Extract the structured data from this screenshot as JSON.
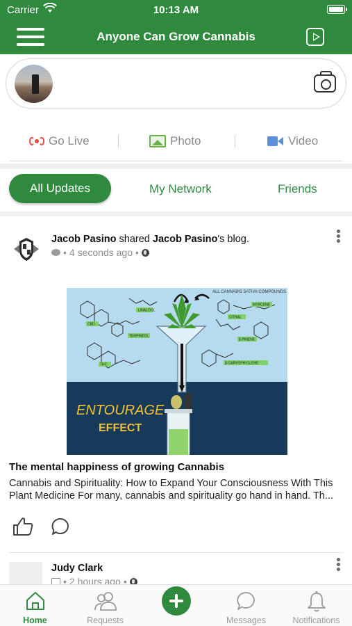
{
  "status_bar": {
    "carrier": "Carrier",
    "time": "10:13 AM"
  },
  "nav": {
    "title": "Anyone Can Grow Cannabis"
  },
  "composer": {
    "actions": [
      {
        "label": "Go Live",
        "icon": "live-icon",
        "color": "#e8493f"
      },
      {
        "label": "Photo",
        "icon": "photo-icon",
        "color": "#6ab04c"
      },
      {
        "label": "Video",
        "icon": "video-camera-icon",
        "color": "#5b8fd9"
      }
    ]
  },
  "filters": [
    {
      "label": "All Updates",
      "active": true
    },
    {
      "label": "My Network",
      "active": false
    },
    {
      "label": "Friends",
      "active": false
    }
  ],
  "posts": [
    {
      "author": "Jacob Pasino",
      "verb": " shared ",
      "target": "Jacob Pasino",
      "suffix": "'s blog.",
      "time": "4 seconds ago",
      "image": {
        "corner_caption": "ALL CANNABIS SATIVA COMPOUNDS",
        "compounds": [
          "LINALOOL",
          "MYRCENE",
          "CBD",
          "TERPINEOL",
          "CITRAL",
          "β-PINENE",
          "β-CARYOPHYLLENE",
          "THC"
        ],
        "headline_1": "ENTOURAGE",
        "headline_2": "EFFECT"
      },
      "title": "The mental happiness of growing Cannabis",
      "excerpt": "Cannabis and Spirituality: How to Expand Your Consciousness With This Plant Medicine For many, cannabis and spirituality go hand in hand. Th..."
    },
    {
      "author": "Judy Clark",
      "time": "2 hours ago"
    }
  ],
  "tabbar": [
    {
      "label": "Home",
      "icon": "home-icon",
      "active": true
    },
    {
      "label": "Requests",
      "icon": "people-icon",
      "active": false
    },
    {
      "label": "Messages",
      "icon": "chat-icon",
      "active": false
    },
    {
      "label": "Notifications",
      "icon": "bell-icon",
      "active": false
    }
  ],
  "colors": {
    "brand": "#2f8a3e",
    "muted": "#8a8a8a"
  }
}
